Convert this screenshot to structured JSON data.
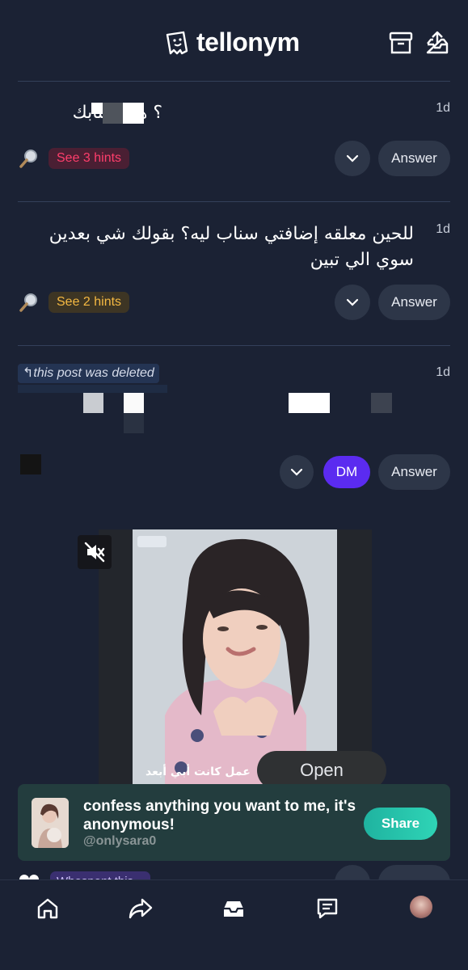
{
  "header": {
    "brand": "tellonym",
    "icons": [
      "archive-icon",
      "inbox-share-icon"
    ]
  },
  "questions": [
    {
      "text": "؟ هذا سنابك",
      "time": "1d",
      "hint_label": "See 3 hints",
      "answer_label": "Answer"
    },
    {
      "text": "للحين معلقه إضافتي سناب ليه؟ بقولك شي بعدين سوي الي تبين",
      "time": "1d",
      "hint_label": "See 2 hints",
      "answer_label": "Answer"
    },
    {
      "deleted_label": "↰this post was deleted",
      "time": "1d",
      "dm_label": "DM",
      "answer_label": "Answer"
    }
  ],
  "video": {
    "open_label": "Open",
    "caption": "عمل كانت أبي أبعد"
  },
  "banner": {
    "title": "confess anything you want to me, it's anonymous!",
    "username": "@onlysara0",
    "share_label": "Share"
  },
  "peek": {
    "pill": "Whospent this"
  },
  "tabbar": {
    "items": [
      "home-icon",
      "share-icon",
      "inbox-icon",
      "chat-icon",
      "profile-avatar"
    ]
  },
  "colors": {
    "background": "#1b2234",
    "pink_hint": "#ff3e6c",
    "amber_hint": "#f5b942",
    "dm": "#5b2bf0",
    "share": "#2fd4b6"
  }
}
